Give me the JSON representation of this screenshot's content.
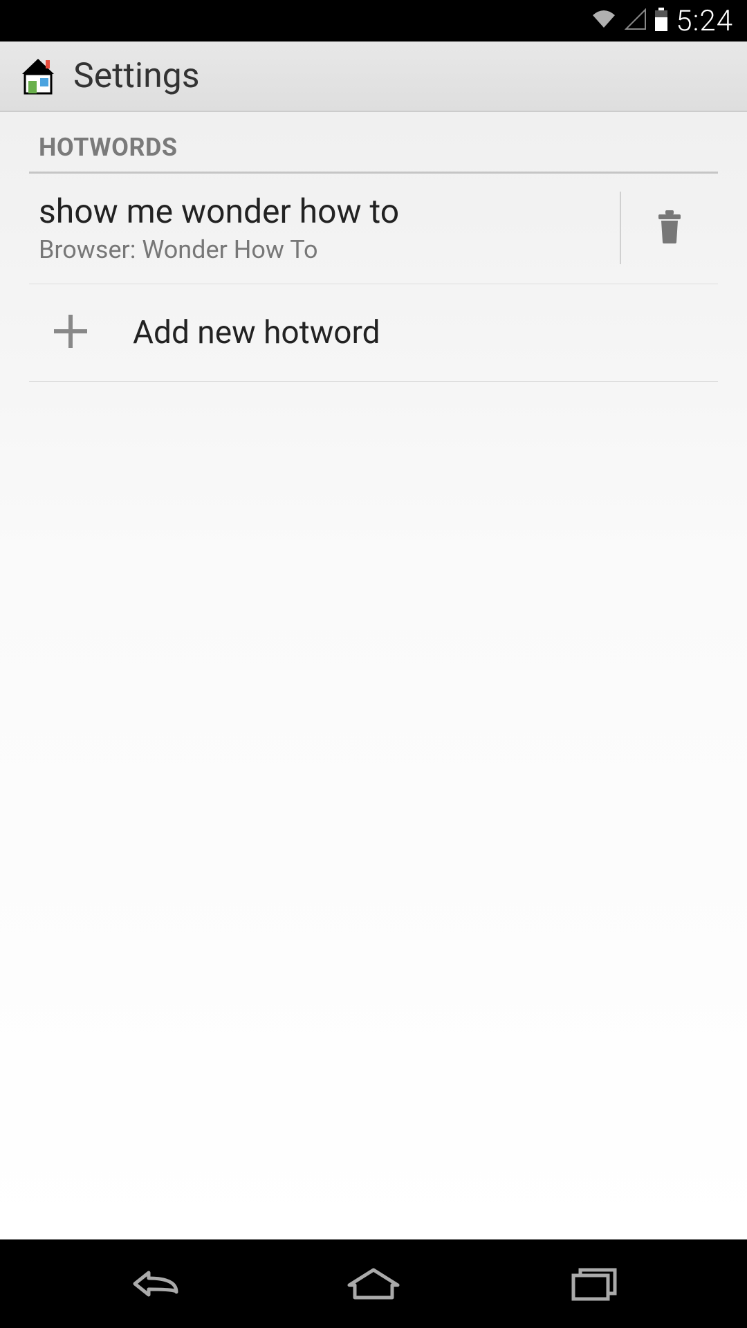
{
  "statusbar": {
    "time": "5:24"
  },
  "actionbar": {
    "title": "Settings"
  },
  "section": {
    "header": "HOTWORDS"
  },
  "hotwords": [
    {
      "title": "show me wonder how to",
      "subtitle": "Browser: Wonder How To"
    }
  ],
  "add": {
    "label": "Add new hotword"
  }
}
